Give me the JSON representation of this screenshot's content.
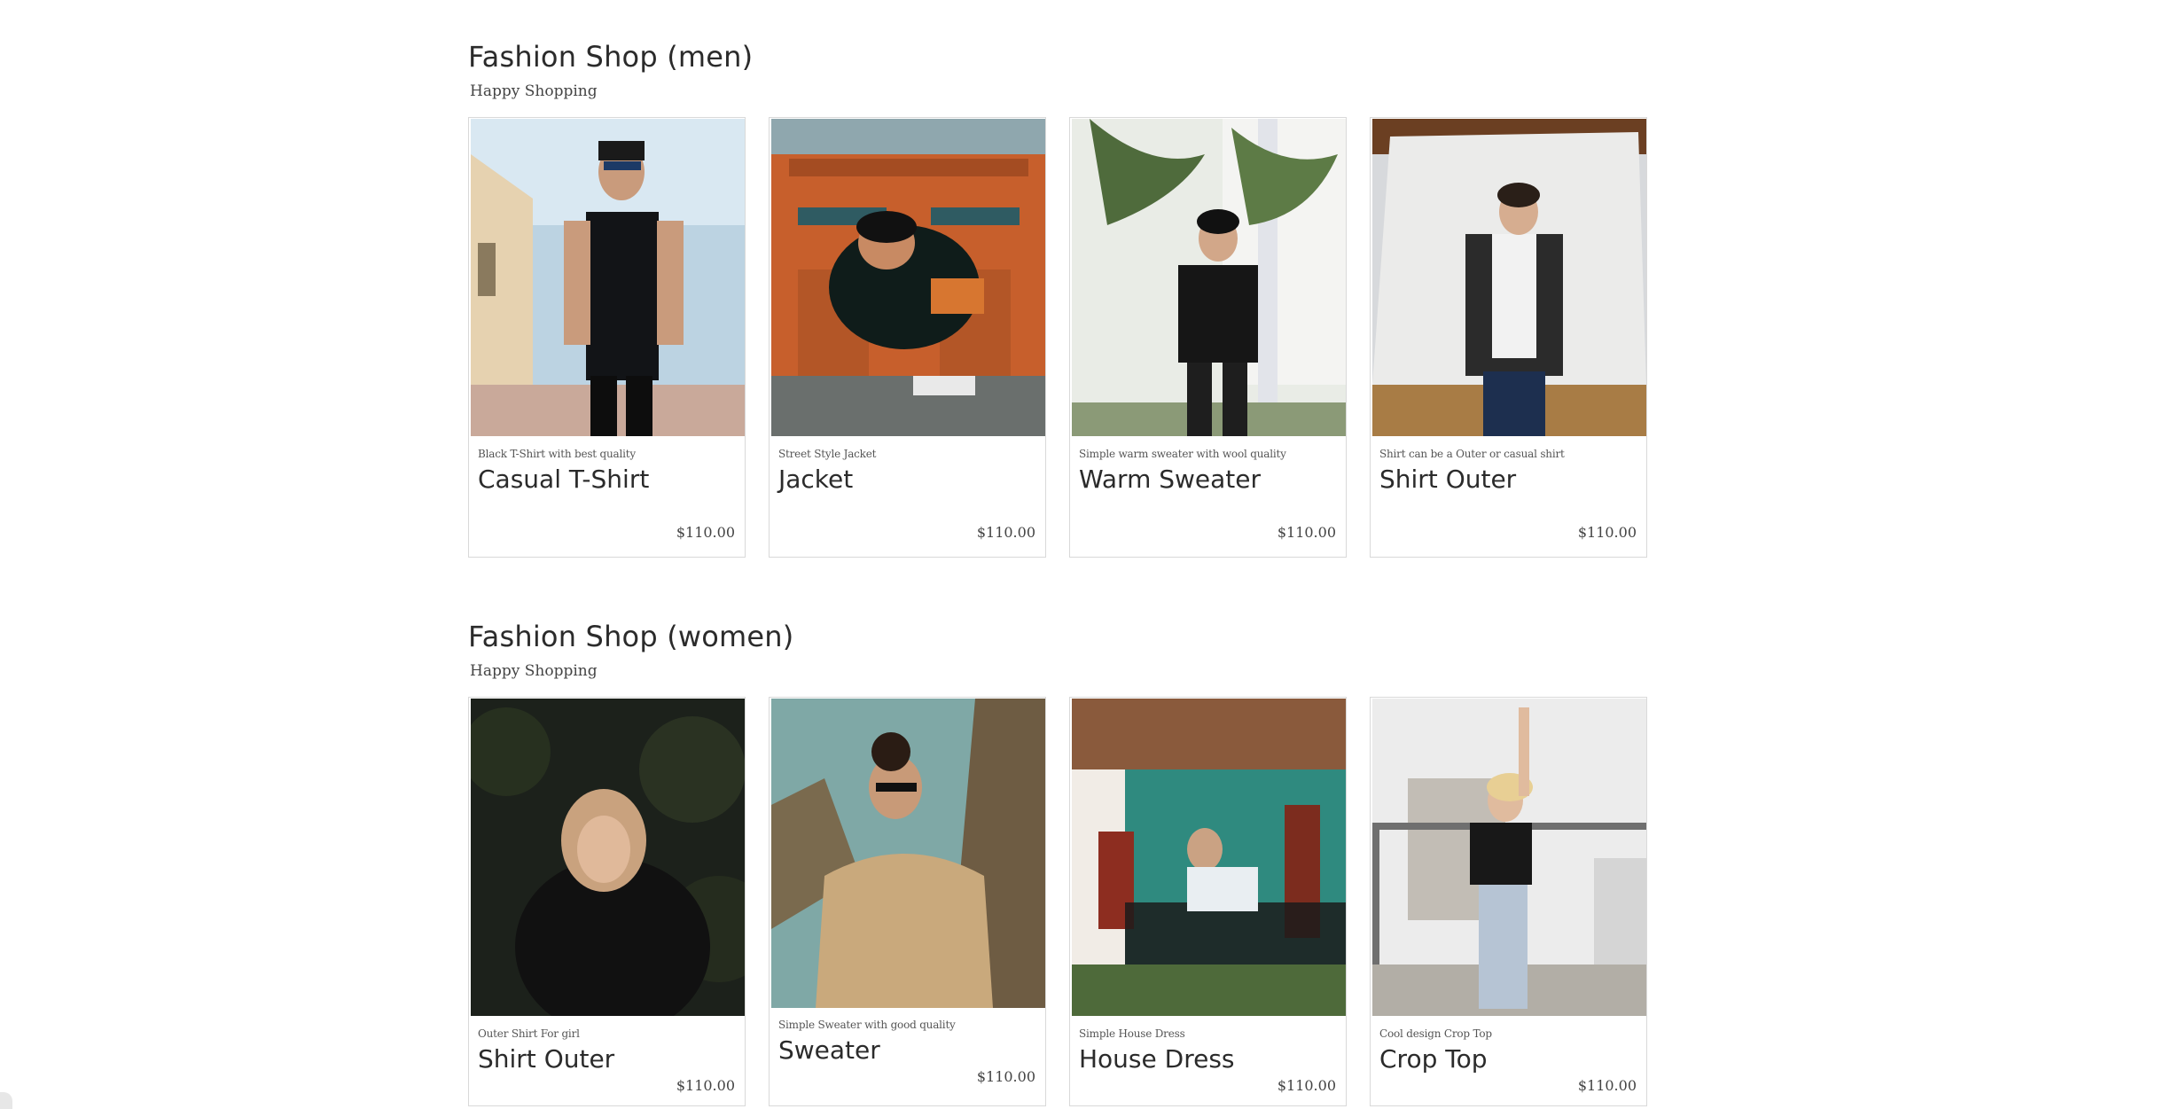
{
  "sections": [
    {
      "title": "Fashion Shop (men)",
      "subtitle": "Happy Shopping",
      "products": [
        {
          "desc": "Black T-Shirt with best quality",
          "name": "Casual T-Shirt",
          "price": "$110.00"
        },
        {
          "desc": "Street Style Jacket",
          "name": "Jacket",
          "price": "$110.00"
        },
        {
          "desc": "Simple warm sweater with wool quality",
          "name": "Warm Sweater",
          "price": "$110.00"
        },
        {
          "desc": "Shirt can be a Outer or casual shirt",
          "name": "Shirt Outer",
          "price": "$110.00"
        }
      ]
    },
    {
      "title": "Fashion Shop (women)",
      "subtitle": "Happy Shopping",
      "products": [
        {
          "desc": "Outer Shirt For girl",
          "name": "Shirt Outer",
          "price": "$110.00"
        },
        {
          "desc": "Simple Sweater with good quality",
          "name": "Sweater",
          "price": "$110.00"
        },
        {
          "desc": "Simple House Dress",
          "name": "House Dress",
          "price": "$110.00"
        },
        {
          "desc": "Cool design Crop Top",
          "name": "Crop Top",
          "price": "$110.00"
        }
      ]
    }
  ]
}
